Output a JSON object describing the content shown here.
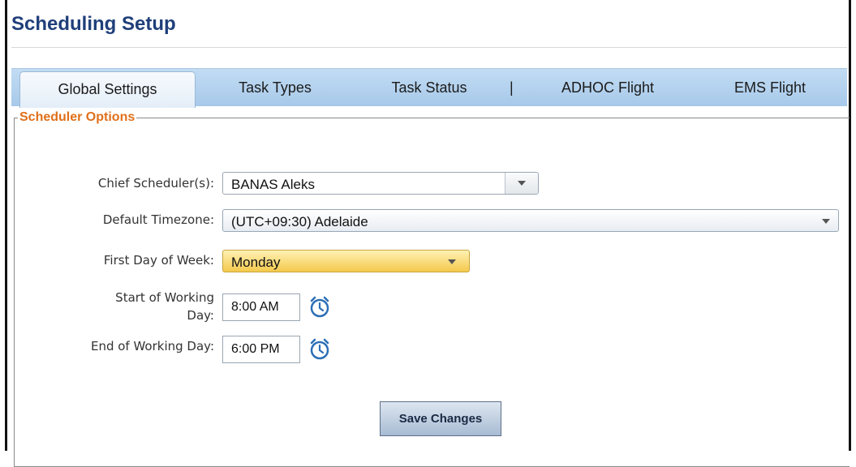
{
  "page": {
    "title": "Scheduling Setup"
  },
  "tabs": [
    {
      "label": "Global Settings",
      "active": true
    },
    {
      "label": "Task Types"
    },
    {
      "label": "Task Status"
    },
    {
      "label": "ADHOC Flight"
    },
    {
      "label": "EMS Flight"
    }
  ],
  "tab_separator": "|",
  "scheduler_options": {
    "legend": "Scheduler Options",
    "chief_scheduler": {
      "label": "Chief Scheduler(s):",
      "value": "BANAS Aleks"
    },
    "default_timezone": {
      "label": "Default Timezone:",
      "value": "(UTC+09:30) Adelaide"
    },
    "first_day_of_week": {
      "label": "First Day of Week:",
      "value": "Monday"
    },
    "start_of_working_day": {
      "label_line1": "Start of Working",
      "label_line2": "Day:",
      "value": "8:00 AM"
    },
    "end_of_working_day": {
      "label": "End of Working Day:",
      "value": "6:00 PM"
    }
  },
  "actions": {
    "save_label": "Save Changes"
  },
  "colors": {
    "title": "#1f3f7a",
    "legend": "#e0701a",
    "tabbar": "#b3d2ef",
    "highlight_select": "#f4c94d",
    "clock_icon": "#2c6fb6"
  },
  "icons": {
    "time_picker": "clock-icon",
    "dropdown": "chevron-down-icon"
  }
}
